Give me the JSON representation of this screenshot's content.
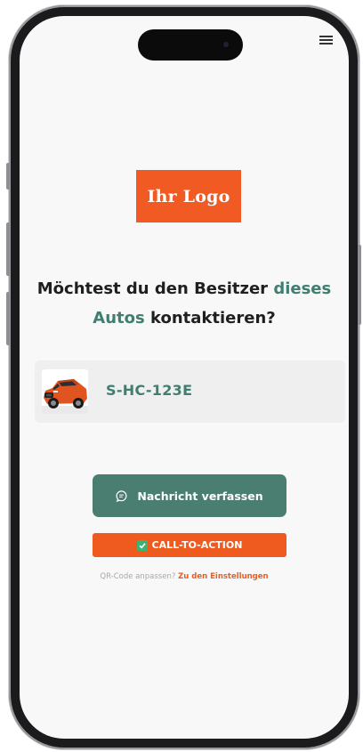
{
  "logo": {
    "text": "Ihr Logo",
    "color": "#f15a22"
  },
  "headline": {
    "part1": "Möchtest du den Besitzer ",
    "accent1": "dieses",
    "accent2": "Autos",
    "part2": " kontaktieren?",
    "accent_color": "#3f7e70"
  },
  "vehicle": {
    "plate": "S-HC-123E",
    "image": "orange-suv-photo"
  },
  "buttons": {
    "message_label": "Nachricht verfassen",
    "message_icon": "chat-bubble-icon",
    "message_color": "#4a7e71",
    "cta_label": "CALL-TO-ACTION",
    "cta_icon": "checkbox-checked-icon",
    "cta_color": "#ef5a1f"
  },
  "footer": {
    "text": "QR-Code anpassen?",
    "link": "Zu den Einstellungen"
  },
  "header": {
    "menu_icon": "hamburger-menu-icon"
  }
}
